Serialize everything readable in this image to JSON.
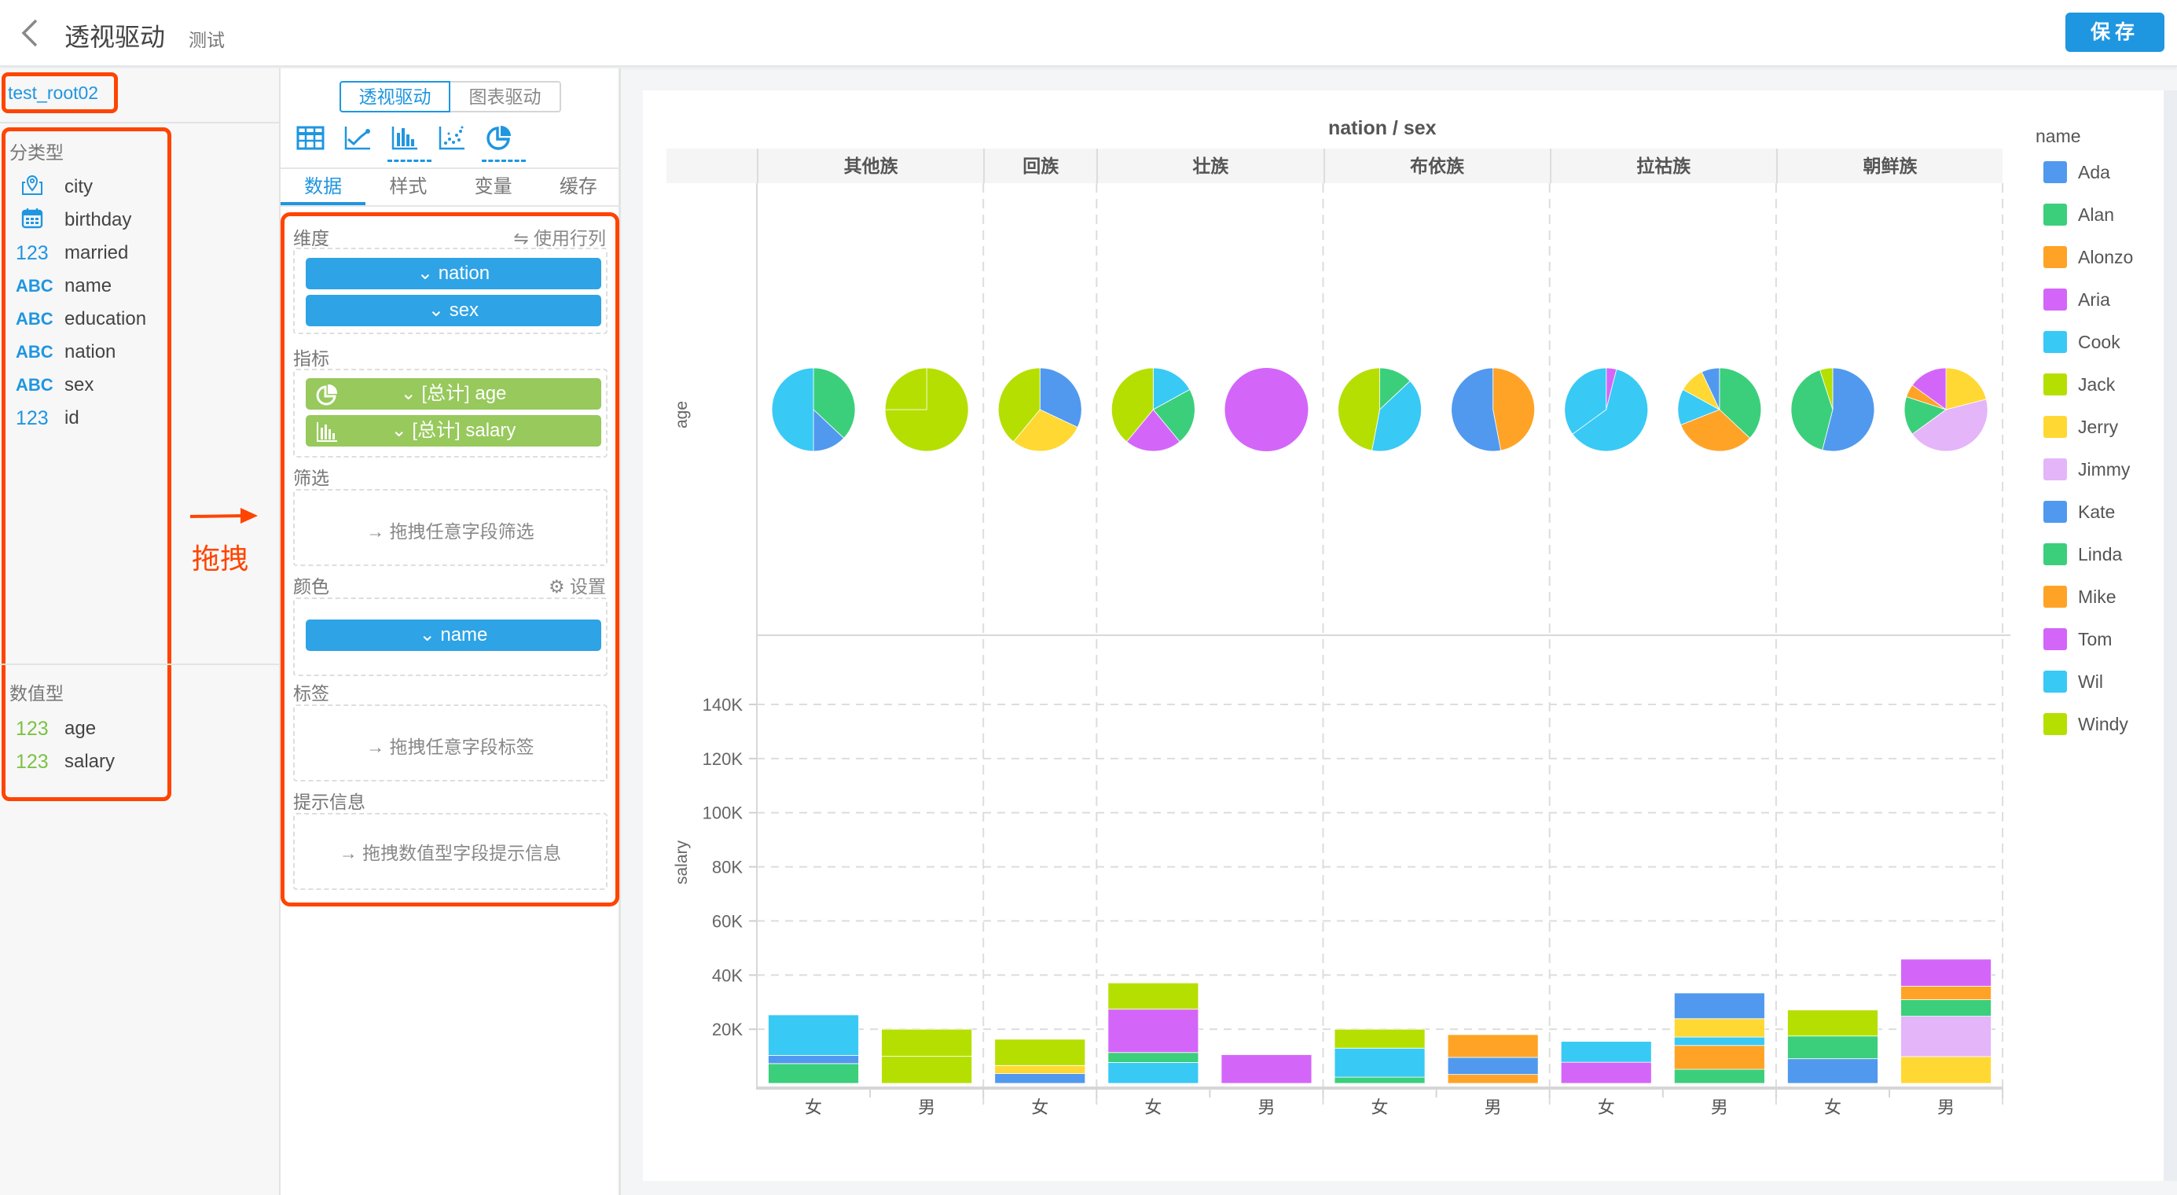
{
  "header": {
    "title": "透视驱动",
    "subtitle": "测试",
    "save_label": "保存"
  },
  "sidebar": {
    "dataset": "test_root02",
    "categorical_title": "分类型",
    "categorical_fields": [
      {
        "type_icon": "map-icon",
        "tag": "",
        "name": "city"
      },
      {
        "type_icon": "calendar-icon",
        "tag": "",
        "name": "birthday"
      },
      {
        "type_icon": "number-icon",
        "tag": "123",
        "name": "married"
      },
      {
        "type_icon": "text-icon",
        "tag": "ABC",
        "name": "name"
      },
      {
        "type_icon": "text-icon",
        "tag": "ABC",
        "name": "education"
      },
      {
        "type_icon": "text-icon",
        "tag": "ABC",
        "name": "nation"
      },
      {
        "type_icon": "text-icon",
        "tag": "ABC",
        "name": "sex"
      },
      {
        "type_icon": "number-icon",
        "tag": "123",
        "name": "id"
      }
    ],
    "numeric_title": "数值型",
    "numeric_fields": [
      {
        "tag": "123",
        "name": "age"
      },
      {
        "tag": "123",
        "name": "salary"
      }
    ],
    "annotation": "拖拽"
  },
  "panel": {
    "mode_tabs": [
      "透视驱动",
      "图表驱动"
    ],
    "active_mode": "透视驱动",
    "chart_types": [
      "table-icon",
      "line-chart-icon",
      "bar-chart-icon",
      "scatter-chart-icon",
      "pie-chart-icon"
    ],
    "tabs": [
      "数据",
      "样式",
      "变量",
      "缓存"
    ],
    "active_tab": "数据",
    "dimensions": {
      "title": "维度",
      "action": "⇋ 使用行列",
      "items": [
        "nation",
        "sex"
      ]
    },
    "metrics": {
      "title": "指标",
      "items": [
        {
          "label": "[总计] age",
          "chart_icon": "pie-chart-icon"
        },
        {
          "label": "[总计] salary",
          "chart_icon": "bar-chart-icon"
        }
      ]
    },
    "filter": {
      "title": "筛选",
      "hint": "→ 拖拽任意字段筛选"
    },
    "color": {
      "title": "颜色",
      "action": "设置",
      "items": [
        "name"
      ]
    },
    "label": {
      "title": "标签",
      "hint": "→ 拖拽任意字段标签"
    },
    "tooltip": {
      "title": "提示信息",
      "hint": "→ 拖拽数值型字段提示信息"
    }
  },
  "colors": {
    "accent": "#1f96e0",
    "highlight": "#ff4400",
    "dimension_pill": "#2ea3e6",
    "metric_pill": "#97c95c"
  },
  "chart_data": {
    "type": "bar",
    "title": "nation / sex",
    "column_groups": [
      {
        "nation": "其他族",
        "sexes": [
          "女",
          "男"
        ]
      },
      {
        "nation": "回族",
        "sexes": [
          "女"
        ]
      },
      {
        "nation": "壮族",
        "sexes": [
          "女",
          "男"
        ]
      },
      {
        "nation": "布依族",
        "sexes": [
          "女",
          "男"
        ]
      },
      {
        "nation": "拉祜族",
        "sexes": [
          "女",
          "男"
        ]
      },
      {
        "nation": "朝鲜族",
        "sexes": [
          "女",
          "男"
        ]
      }
    ],
    "legend_title": "name",
    "legend": [
      {
        "name": "Ada",
        "color": "#5199ee"
      },
      {
        "name": "Alan",
        "color": "#3bcf7c"
      },
      {
        "name": "Alonzo",
        "color": "#ffa326"
      },
      {
        "name": "Aria",
        "color": "#d366f9"
      },
      {
        "name": "Cook",
        "color": "#39c9f5"
      },
      {
        "name": "Jack",
        "color": "#b5df00"
      },
      {
        "name": "Jerry",
        "color": "#ffd833"
      },
      {
        "name": "Jimmy",
        "color": "#e4b5f8"
      },
      {
        "name": "Kate",
        "color": "#5199ee"
      },
      {
        "name": "Linda",
        "color": "#3bcf7c"
      },
      {
        "name": "Mike",
        "color": "#ffa326"
      },
      {
        "name": "Tom",
        "color": "#d366f9"
      },
      {
        "name": "Wil",
        "color": "#39c9f5"
      },
      {
        "name": "Windy",
        "color": "#b5df00"
      }
    ],
    "pie_row": {
      "ylabel": "age",
      "type": "pie",
      "pies": [
        [
          {
            "name": "Alan",
            "value": 37
          },
          {
            "name": "Ada",
            "value": 13
          },
          {
            "name": "Cook",
            "value": 50
          }
        ],
        [
          {
            "name": "Jack",
            "value": 75
          },
          {
            "name": "Windy",
            "value": 25
          }
        ],
        [
          {
            "name": "Ada",
            "value": 32
          },
          {
            "name": "Jerry",
            "value": 29
          },
          {
            "name": "Jack",
            "value": 39
          }
        ],
        [
          {
            "name": "Cook",
            "value": 17
          },
          {
            "name": "Alan",
            "value": 22
          },
          {
            "name": "Aria",
            "value": 22
          },
          {
            "name": "Jack",
            "value": 39
          }
        ],
        [
          {
            "name": "Aria",
            "value": 100
          }
        ],
        [
          {
            "name": "Alan",
            "value": 13
          },
          {
            "name": "Cook",
            "value": 40
          },
          {
            "name": "Jack",
            "value": 47
          }
        ],
        [
          {
            "name": "Alonzo",
            "value": 47
          },
          {
            "name": "Ada",
            "value": 53
          }
        ],
        [
          {
            "name": "Aria",
            "value": 4
          },
          {
            "name": "Cook",
            "value": 61
          },
          {
            "name": "Wil",
            "value": 35
          }
        ],
        [
          {
            "name": "Alan",
            "value": 37
          },
          {
            "name": "Alonzo",
            "value": 32
          },
          {
            "name": "Cook",
            "value": 14
          },
          {
            "name": "Jerry",
            "value": 10
          },
          {
            "name": "Ada",
            "value": 7
          }
        ],
        [
          {
            "name": "Ada",
            "value": 54
          },
          {
            "name": "Alan",
            "value": 41
          },
          {
            "name": "Jack",
            "value": 5
          }
        ],
        [
          {
            "name": "Jerry",
            "value": 21
          },
          {
            "name": "Jimmy",
            "value": 44
          },
          {
            "name": "Alan",
            "value": 15
          },
          {
            "name": "Alonzo",
            "value": 5
          },
          {
            "name": "Aria",
            "value": 15
          }
        ]
      ]
    },
    "bar_row": {
      "ylabel": "salary",
      "type": "stacked-bar",
      "ylim": [
        0,
        140000
      ],
      "yticks": [
        20000,
        40000,
        60000,
        80000,
        100000,
        120000,
        140000
      ],
      "ytick_labels": [
        "20K",
        "40K",
        "60K",
        "80K",
        "100K",
        "120K",
        "140K"
      ],
      "grid": true,
      "bars": [
        [
          {
            "name": "Alan",
            "value": 7300
          },
          {
            "name": "Ada",
            "value": 3000
          },
          {
            "name": "Cook",
            "value": 15000
          }
        ],
        [
          {
            "name": "Jack",
            "value": 10000
          },
          {
            "name": "Windy",
            "value": 10000
          }
        ],
        [
          {
            "name": "Ada",
            "value": 3600
          },
          {
            "name": "Jerry",
            "value": 3000
          },
          {
            "name": "Jack",
            "value": 9700
          }
        ],
        [
          {
            "name": "Cook",
            "value": 7700
          },
          {
            "name": "Alan",
            "value": 3700
          },
          {
            "name": "Aria",
            "value": 16000
          },
          {
            "name": "Jack",
            "value": 9700
          }
        ],
        [
          {
            "name": "Aria",
            "value": 10600
          }
        ],
        [
          {
            "name": "Alan",
            "value": 2300
          },
          {
            "name": "Cook",
            "value": 10700
          },
          {
            "name": "Jack",
            "value": 7000
          }
        ],
        [
          {
            "name": "Alonzo",
            "value": 3300
          },
          {
            "name": "Ada",
            "value": 6300
          },
          {
            "name": "Mike",
            "value": 8400
          }
        ],
        [
          {
            "name": "Aria",
            "value": 7800
          },
          {
            "name": "Cook",
            "value": 7700
          }
        ],
        [
          {
            "name": "Alan",
            "value": 5200
          },
          {
            "name": "Alonzo",
            "value": 8800
          },
          {
            "name": "Cook",
            "value": 3100
          },
          {
            "name": "Jerry",
            "value": 6800
          },
          {
            "name": "Ada",
            "value": 9500
          }
        ],
        [
          {
            "name": "Ada",
            "value": 9100
          },
          {
            "name": "Alan",
            "value": 8400
          },
          {
            "name": "Jack",
            "value": 9600
          }
        ],
        [
          {
            "name": "Jerry",
            "value": 9900
          },
          {
            "name": "Jimmy",
            "value": 14900
          },
          {
            "name": "Alan",
            "value": 6100
          },
          {
            "name": "Alonzo",
            "value": 5000
          },
          {
            "name": "Aria",
            "value": 10000
          }
        ]
      ]
    }
  }
}
